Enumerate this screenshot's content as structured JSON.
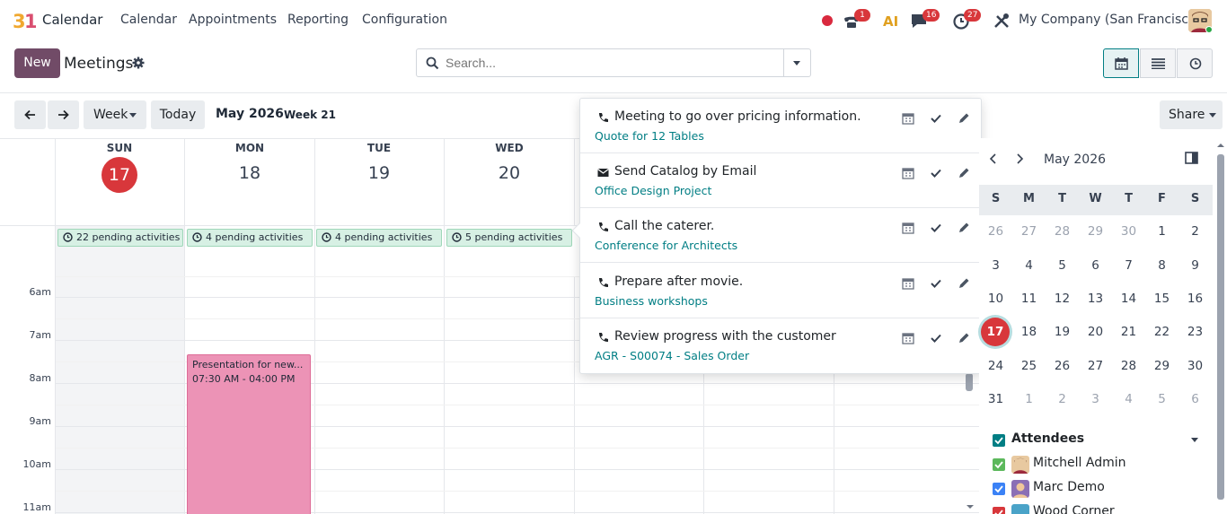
{
  "navbar": {
    "app_icon_label": "31",
    "app_name": "Calendar",
    "menu": [
      "Calendar",
      "Appointments",
      "Reporting",
      "Configuration"
    ],
    "badges": {
      "activities_phone": "1",
      "messages": "16",
      "activities": "27"
    },
    "ai_label": "AI",
    "company": "My Company (San Francisco)"
  },
  "control": {
    "new_label": "New",
    "title": "Meetings",
    "search_placeholder": "Search..."
  },
  "toolbar": {
    "scale_label": "Week",
    "today_label": "Today",
    "date_title": "May 2026",
    "week_label": "Week 21",
    "share_label": "Share"
  },
  "calendar": {
    "days": [
      {
        "name": "SUN",
        "num": "17",
        "pending": "22 pending activities"
      },
      {
        "name": "MON",
        "num": "18",
        "pending": "4 pending activities"
      },
      {
        "name": "TUE",
        "num": "19",
        "pending": "4 pending activities"
      },
      {
        "name": "WED",
        "num": "20",
        "pending": "5 pending activities"
      }
    ],
    "hours": [
      "6am",
      "7am",
      "8am",
      "9am",
      "10am",
      "11am"
    ],
    "event": {
      "title": "Presentation for new...",
      "time": "07:30 AM - 04:00 PM"
    }
  },
  "popover": {
    "items": [
      {
        "icon": "phone-icon",
        "title": "Meeting to go over pricing information.",
        "sub": "Quote for 12 Tables"
      },
      {
        "icon": "envelope-icon",
        "title": "Send Catalog by Email",
        "sub": "Office Design Project"
      },
      {
        "icon": "phone-icon",
        "title": "Call the caterer.",
        "sub": "Conference for Architects"
      },
      {
        "icon": "phone-icon",
        "title": "Prepare after movie.",
        "sub": "Business workshops"
      },
      {
        "icon": "phone-icon",
        "title": "Review progress with the customer",
        "sub": "AGR - S00074 - Sales Order"
      }
    ]
  },
  "mini_calendar": {
    "month": "May 2026",
    "dow": [
      "S",
      "M",
      "T",
      "W",
      "T",
      "F",
      "S"
    ],
    "weeks": [
      [
        "26",
        "27",
        "28",
        "29",
        "30",
        "1",
        "2"
      ],
      [
        "3",
        "4",
        "5",
        "6",
        "7",
        "8",
        "9"
      ],
      [
        "10",
        "11",
        "12",
        "13",
        "14",
        "15",
        "16"
      ],
      [
        "17",
        "18",
        "19",
        "20",
        "21",
        "22",
        "23"
      ],
      [
        "24",
        "25",
        "26",
        "27",
        "28",
        "29",
        "30"
      ],
      [
        "31",
        "1",
        "2",
        "3",
        "4",
        "5",
        "6"
      ]
    ],
    "today": "17"
  },
  "attendees": {
    "header": "Attendees",
    "list": [
      {
        "name": "Mitchell Admin",
        "color": "#5cb85c"
      },
      {
        "name": "Marc Demo",
        "color": "#3b82f6"
      },
      {
        "name": "Wood Corner",
        "color": "#d8373b"
      }
    ]
  },
  "colors": {
    "primary": "#714b67",
    "accent": "#017e84",
    "today": "#d8373b",
    "event": "#ec93b6"
  }
}
